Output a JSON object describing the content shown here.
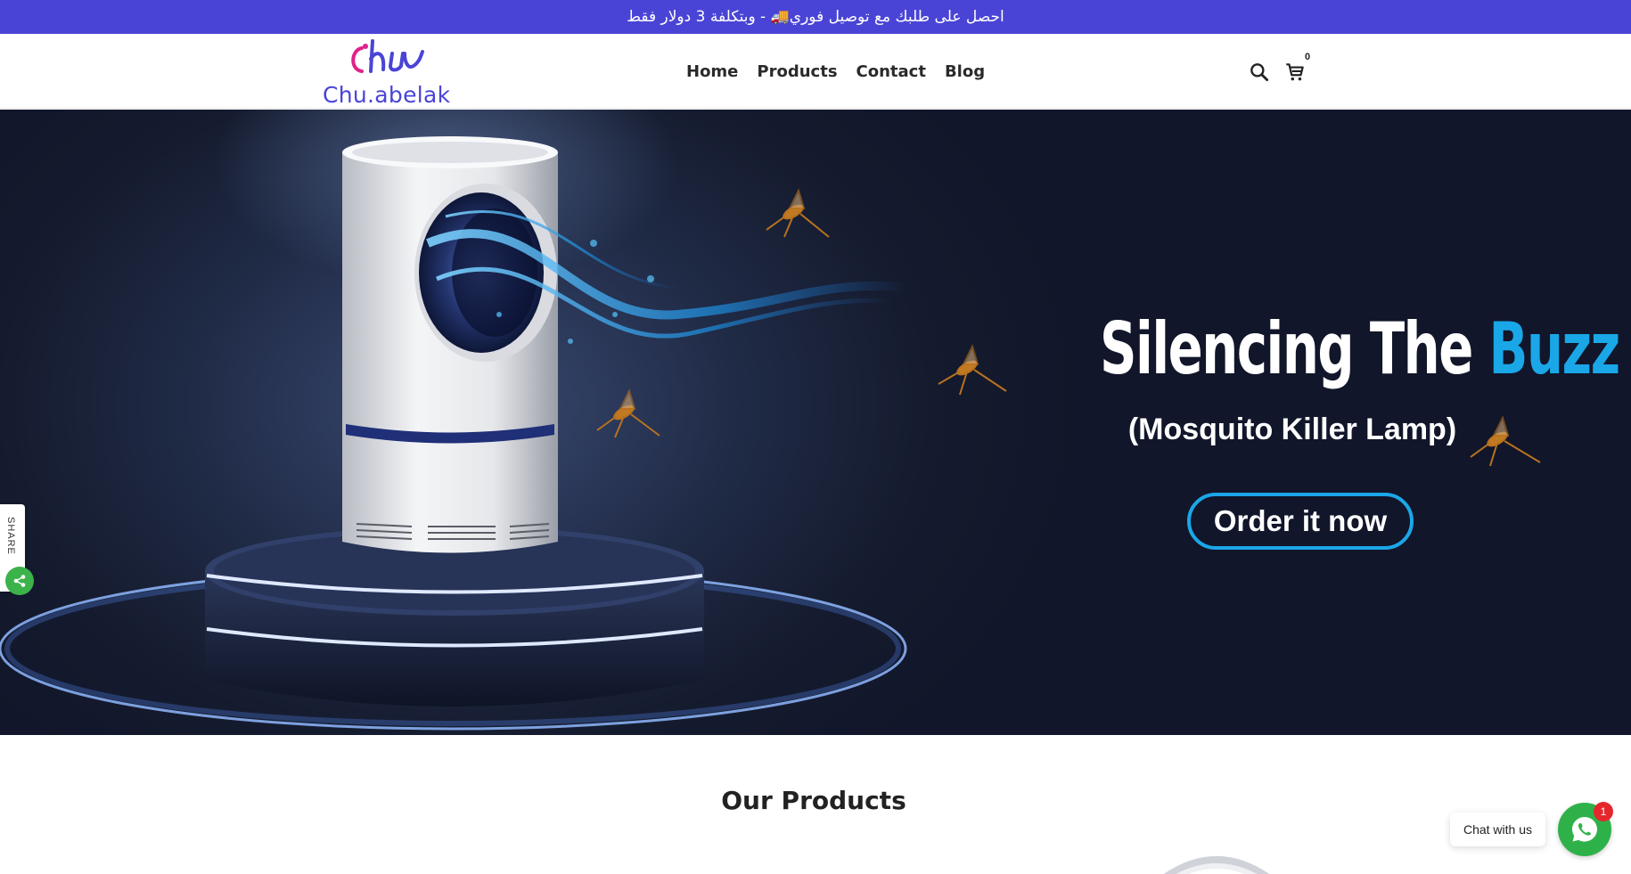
{
  "announcement": {
    "text": "احصل على طلبك مع توصيل فوري🚚 - وبتكلفة 3 دولار فقط"
  },
  "header": {
    "logo_text": "Chu.abelak",
    "nav": [
      "Home",
      "Products",
      "Contact",
      "Blog"
    ],
    "cart_count": "0",
    "icons": [
      "search-icon",
      "cart-icon"
    ]
  },
  "hero": {
    "title_main": "Silencing The ",
    "title_accent": "Buzz",
    "subtitle": "(Mosquito Killer Lamp)",
    "cta_label": "Order it now",
    "accent_color": "#1aa7e8"
  },
  "share": {
    "label": "SHARE",
    "icon": "share-icon"
  },
  "products": {
    "heading": "Our Products"
  },
  "chat": {
    "label": "Chat with us",
    "badge": "1",
    "icon": "whatsapp-icon"
  },
  "colors": {
    "brand": "#4a44d6",
    "chat_green": "#2fb14a",
    "share_green": "#3bb34a",
    "badge_red": "#e5272d"
  }
}
